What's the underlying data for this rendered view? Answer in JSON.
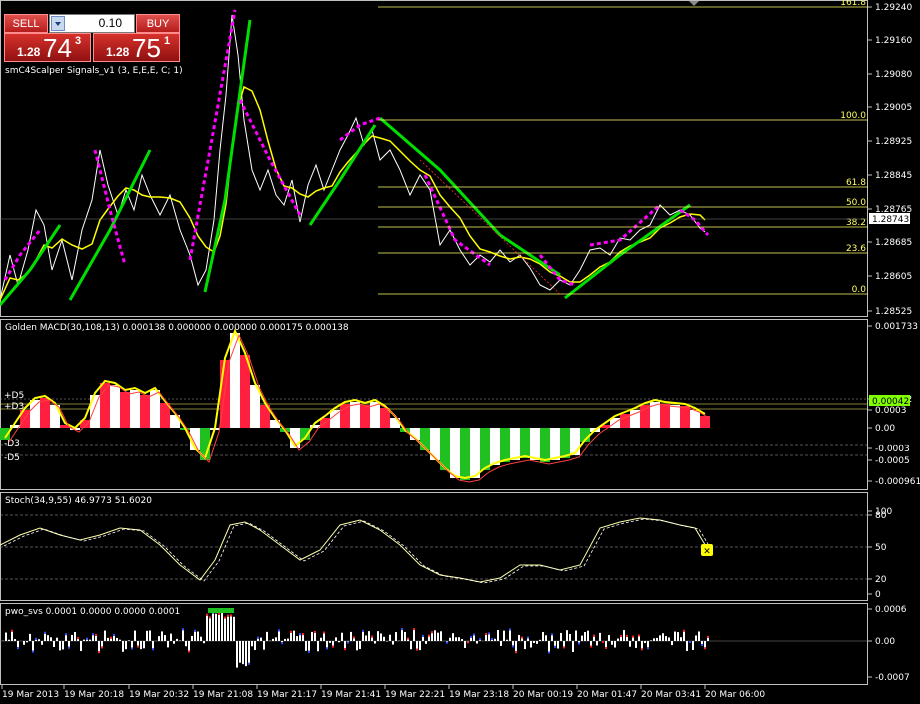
{
  "toolbar": {
    "sell_label": "SELL",
    "buy_label": "BUY",
    "lot": "0.10",
    "sell_small": "1.28",
    "sell_big": "74",
    "sell_sup": "3",
    "buy_small": "1.28",
    "buy_big": "75",
    "buy_sup": "1"
  },
  "indicators": {
    "main": "smC4Scalper Signals_v1 (3, E,E,E, C; 1)",
    "macd": "Golden MACD(30,108,13) 0.000138 0.000000 0.000000 0.000175 0.000138",
    "stoch": "Stoch(34,9,55) 46.9773 51.6020",
    "pwo": "pwo_svs 0.0001 0.0000 0.0000 0.0001"
  },
  "price_axis": [
    "1.29240",
    "1.29160",
    "1.29080",
    "1.29005",
    "1.28925",
    "1.28845",
    "1.28765",
    "1.28685",
    "1.28605",
    "1.28525"
  ],
  "current_price": "1.28743",
  "fib_levels": [
    {
      "label": "161.8"
    },
    {
      "label": "100.0"
    },
    {
      "label": "61.8"
    },
    {
      "label": "50.0"
    },
    {
      "label": "38.2"
    },
    {
      "label": "23.6"
    },
    {
      "label": "0.0"
    }
  ],
  "macd_axis": [
    "0.001733",
    "0.00042",
    "0.0003",
    "0.00",
    "-0.0003",
    "-0.0005",
    "-0.000961"
  ],
  "macd_levels": [
    "+D5",
    "+D3",
    "-D3",
    "-D5"
  ],
  "stoch_axis": [
    "100",
    "80",
    "50",
    "20",
    "0"
  ],
  "pwo_axis": [
    "0.0006",
    "0.00",
    "-0.0007"
  ],
  "time_axis": [
    "19 Mar 2013",
    "19 Mar 20:18",
    "19 Mar 20:32",
    "19 Mar 21:08",
    "19 Mar 21:17",
    "19 Mar 21:41",
    "19 Mar 22:21",
    "19 Mar 23:18",
    "20 Mar 00:19",
    "20 Mar 01:47",
    "20 Mar 03:41",
    "20 Mar 06:00"
  ],
  "colors": {
    "price": "#ffffff",
    "ma": "#ffff00",
    "bull": "#00e000",
    "bear": "#ff00ff",
    "fib": "#ffff66",
    "macd_pos": "#ff2040",
    "macd_neg": "#20c020",
    "signal": "#ffff00",
    "grid": "#c0c0c0"
  }
}
